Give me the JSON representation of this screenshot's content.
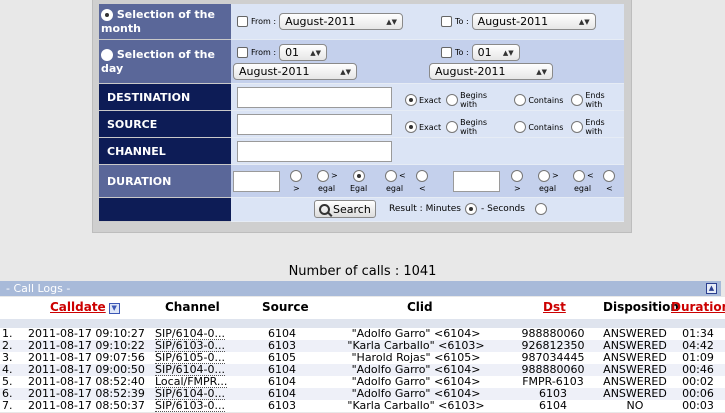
{
  "filters": {
    "month": {
      "label": "Selection of the month",
      "from_label": "From :",
      "to_label": "To :",
      "from_value": "August-2011",
      "to_value": "August-2011"
    },
    "day": {
      "label": "Selection of the day",
      "from_label": "From :",
      "to_label": "To :",
      "from_day": "01",
      "to_day": "01",
      "from_month": "August-2011",
      "to_month": "August-2011"
    },
    "destination": {
      "label": "DESTINATION",
      "value": ""
    },
    "source": {
      "label": "SOURCE",
      "value": ""
    },
    "channel": {
      "label": "CHANNEL",
      "value": ""
    },
    "duration": {
      "label": "DURATION",
      "value1": "",
      "value2": ""
    },
    "match_options": {
      "exact": "Exact",
      "begins": "Begins with",
      "contains": "Contains",
      "ends": "Ends with"
    },
    "duration_ops": {
      "gt": ">",
      "gte_top": ">",
      "gte_bottom": "egal",
      "eq": "Egal",
      "lte_bottom": "egal",
      "lt": "<"
    },
    "search_label": "Search",
    "result_label": "Result : Minutes",
    "seconds_label": "- Seconds"
  },
  "results": {
    "count_text": "Number of calls : 1041",
    "section_title": "- Call Logs -",
    "columns": {
      "calldate": "Calldate",
      "channel": "Channel",
      "source": "Source",
      "clid": "Clid",
      "dst": "Dst",
      "disposition": "Disposition",
      "duration": "Duration"
    },
    "rows": [
      {
        "num": "1.",
        "calldate": "2011-08-17 09:10:27",
        "channel": "SIP/6104-0...",
        "source": "6104",
        "clid": "\"Adolfo Garro\" <6104>",
        "dst": "988880060",
        "disposition": "ANSWERED",
        "duration": "01:34"
      },
      {
        "num": "2.",
        "calldate": "2011-08-17 09:10:22",
        "channel": "SIP/6103-0...",
        "source": "6103",
        "clid": "\"Karla Carballo\" <6103>",
        "dst": "926812350",
        "disposition": "ANSWERED",
        "duration": "04:42"
      },
      {
        "num": "3.",
        "calldate": "2011-08-17 09:07:56",
        "channel": "SIP/6105-0...",
        "source": "6105",
        "clid": "\"Harold Rojas\" <6105>",
        "dst": "987034445",
        "disposition": "ANSWERED",
        "duration": "01:09"
      },
      {
        "num": "4.",
        "calldate": "2011-08-17 09:00:50",
        "channel": "SIP/6104-0...",
        "source": "6104",
        "clid": "\"Adolfo Garro\" <6104>",
        "dst": "988880060",
        "disposition": "ANSWERED",
        "duration": "00:46"
      },
      {
        "num": "5.",
        "calldate": "2011-08-17 08:52:40",
        "channel": "Local/FMPR...",
        "source": "6104",
        "clid": "\"Adolfo Garro\" <6104>",
        "dst": "FMPR-6103",
        "disposition": "ANSWERED",
        "duration": "00:02"
      },
      {
        "num": "6.",
        "calldate": "2011-08-17 08:52:39",
        "channel": "SIP/6104-0...",
        "source": "6104",
        "clid": "\"Adolfo Garro\" <6104>",
        "dst": "6103",
        "disposition": "ANSWERED",
        "duration": "00:06"
      },
      {
        "num": "7.",
        "calldate": "2011-08-17 08:50:37",
        "channel": "SIP/6103-0...",
        "source": "6103",
        "clid": "\"Karla Carballo\" <6103>",
        "dst": "6104",
        "disposition": "NO",
        "duration": "00:03"
      }
    ]
  }
}
